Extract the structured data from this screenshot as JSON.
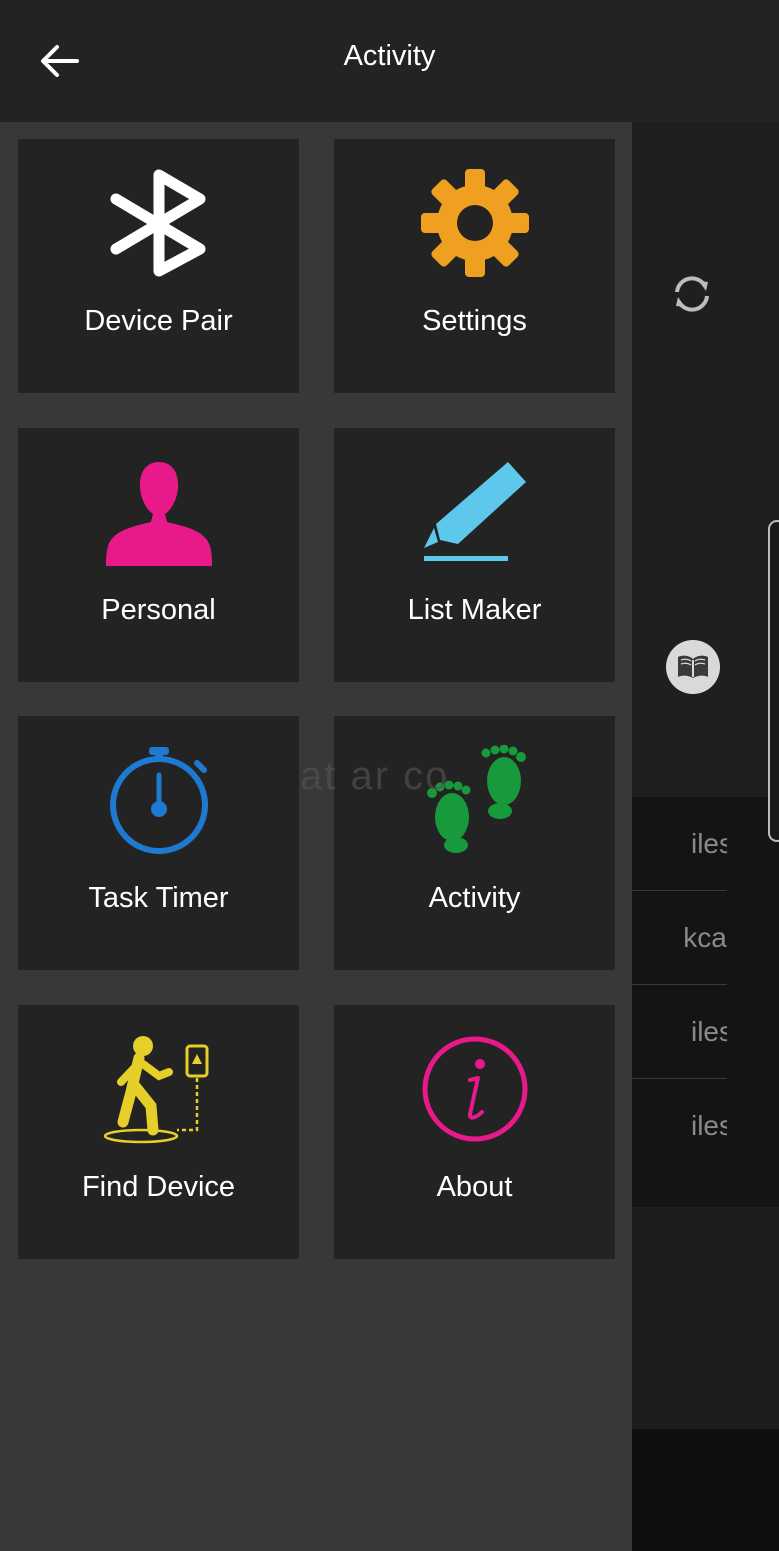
{
  "appbar": {
    "title": "Activity",
    "back_icon": "arrow-left-icon"
  },
  "menu": [
    {
      "label": "Device Pair",
      "icon": "bluetooth-icon",
      "color": "#ffffff"
    },
    {
      "label": "Settings",
      "icon": "gear-icon",
      "color": "#f0a020"
    },
    {
      "label": "Personal",
      "icon": "person-icon",
      "color": "#e8198b"
    },
    {
      "label": "List Maker",
      "icon": "pencil-icon",
      "color": "#5ec7ec"
    },
    {
      "label": "Task Timer",
      "icon": "stopwatch-icon",
      "color": "#1e7ad1"
    },
    {
      "label": "Activity",
      "icon": "footprints-icon",
      "color": "#169a3c"
    },
    {
      "label": "Find Device",
      "icon": "walking-person-icon",
      "color": "#e6cf2a"
    },
    {
      "label": "About",
      "icon": "info-icon",
      "color": "#e8198b"
    }
  ],
  "background": {
    "rows": [
      "iles",
      "kcal",
      "iles",
      "iles"
    ],
    "watermark": "at ar co"
  }
}
